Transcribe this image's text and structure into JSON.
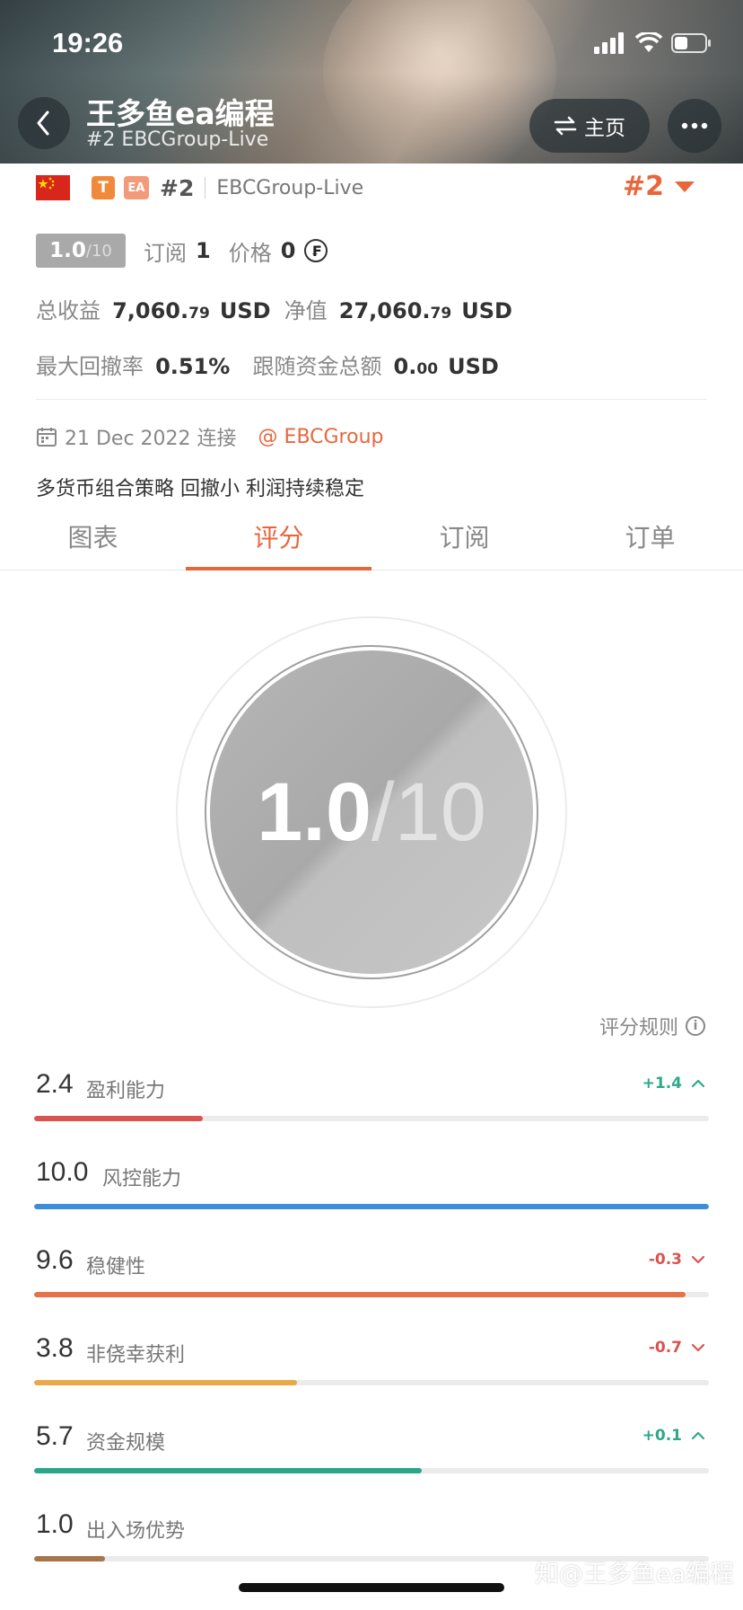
{
  "status_bar": {
    "time": "19:26"
  },
  "header": {
    "title": "王多鱼ea编程",
    "subtitle": "#2 EBCGroup-Live",
    "home_label": "主页"
  },
  "account": {
    "rank": "#2",
    "server": "EBCGroup-Live",
    "badges": [
      "T",
      "EA"
    ],
    "rank_right": "#2",
    "score": "1.0",
    "score_den": "/10",
    "subscribe_label": "订阅",
    "subscribe_value": "1",
    "price_label": "价格",
    "price_value": "0",
    "coin_symbol": "₣",
    "profit_label": "总收益",
    "profit_int": "7,060.",
    "profit_dec": "79",
    "currency": "USD",
    "equity_label": "净值",
    "equity_int": "27,060.",
    "equity_dec": "79",
    "drawdown_label": "最大回撤率",
    "drawdown_value": "0.51%",
    "follow_label": "跟随资金总额",
    "follow_int": "0.",
    "follow_dec": "00",
    "connect_date": "21 Dec 2022 连接",
    "broker": "@ EBCGroup",
    "description": "多货币组合策略 回撤小 利润持续稳定"
  },
  "tabs": [
    {
      "label": "图表",
      "active": false
    },
    {
      "label": "评分",
      "active": true
    },
    {
      "label": "订阅",
      "active": false
    },
    {
      "label": "订单",
      "active": false
    }
  ],
  "rating": {
    "score": "1.0",
    "slash": "/",
    "max": "10",
    "rules_label": "评分规则",
    "metrics": [
      {
        "value": "2.4",
        "label": "盈利能力",
        "change": "+1.4",
        "direction": "up",
        "fraction": 0.25,
        "color": "#d9534f"
      },
      {
        "value": "10.0",
        "label": "风控能力",
        "change": "",
        "direction": "",
        "fraction": 1.0,
        "color": "#3d8ed9"
      },
      {
        "value": "9.6",
        "label": "稳健性",
        "change": "-0.3",
        "direction": "down",
        "fraction": 0.965,
        "color": "#e5734a"
      },
      {
        "value": "3.8",
        "label": "非侥幸获利",
        "change": "-0.7",
        "direction": "down",
        "fraction": 0.39,
        "color": "#eaa84a"
      },
      {
        "value": "5.7",
        "label": "资金规模",
        "change": "+0.1",
        "direction": "up",
        "fraction": 0.575,
        "color": "#28a889"
      },
      {
        "value": "1.0",
        "label": "出入场优势",
        "change": "",
        "direction": "",
        "fraction": 0.105,
        "color": "#a8744a"
      }
    ]
  },
  "colors": {
    "accent": "#e8663c",
    "up": "#2fa88a",
    "down": "#d9534f"
  },
  "watermark": "知@王多鱼ea编程"
}
